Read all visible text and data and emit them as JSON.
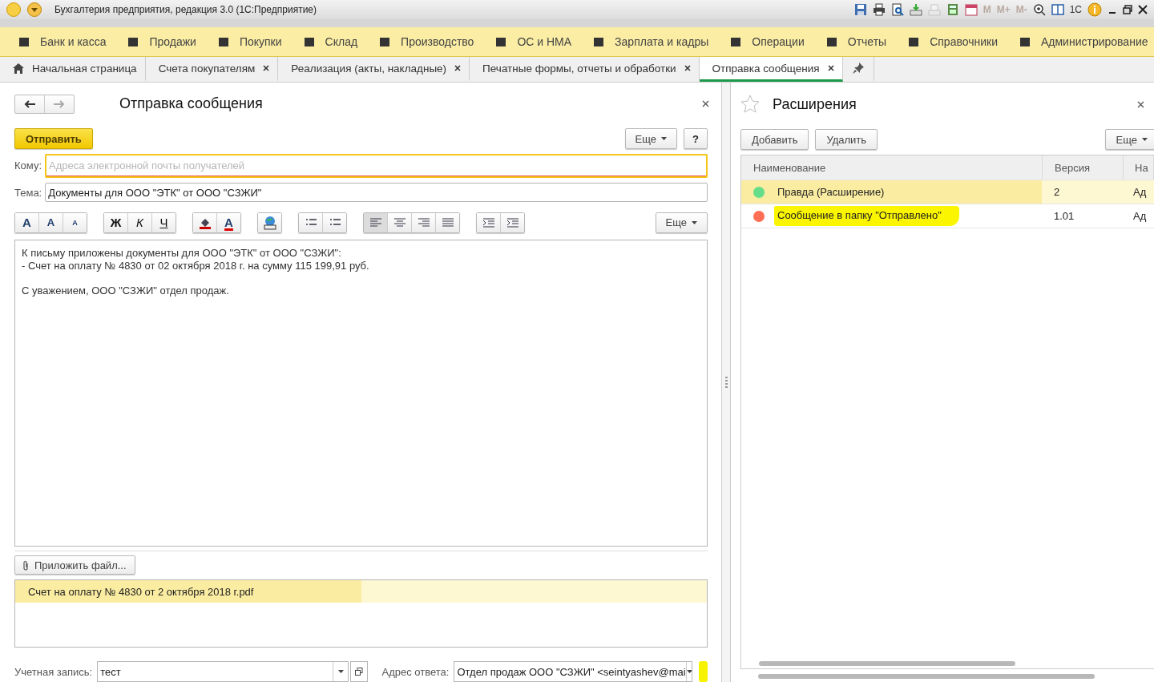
{
  "window": {
    "title": "Бухгалтерия предприятия, редакция 3.0  (1С:Предприятие)",
    "memory_buttons": [
      "M",
      "M+",
      "M-"
    ],
    "user": "1С"
  },
  "sections": [
    {
      "label": "Банк и касса"
    },
    {
      "label": "Продажи"
    },
    {
      "label": "Покупки"
    },
    {
      "label": "Склад"
    },
    {
      "label": "Производство"
    },
    {
      "label": "ОС и НМА"
    },
    {
      "label": "Зарплата и кадры"
    },
    {
      "label": "Операции"
    },
    {
      "label": "Отчеты"
    },
    {
      "label": "Справочники"
    },
    {
      "label": "Администрирование"
    }
  ],
  "tabs": [
    {
      "label": "Начальная страница",
      "kind": "home",
      "selected": false
    },
    {
      "label": "Счета покупателям",
      "kind": "document",
      "selected": false
    },
    {
      "label": "Реализация (акты, накладные)",
      "kind": "document",
      "selected": false
    },
    {
      "label": "Печатные формы, отчеты и обработки",
      "kind": "document",
      "selected": false
    },
    {
      "label": "Отправка сообщения",
      "kind": "document",
      "selected": true
    }
  ],
  "form": {
    "title": "Отправка сообщения",
    "send_button": "Отправить",
    "more_button": "Еще",
    "help_button": "?",
    "to": {
      "label": "Кому:",
      "placeholder": "Адреса электронной почты получателей"
    },
    "subject": {
      "label": "Тема:",
      "value": "Документы для ООО \"ЭТК\" от ООО \"СЗЖИ\""
    },
    "format_groups": [
      [
        {
          "kind": "font",
          "label": "A"
        },
        {
          "kind": "grow",
          "label": "A"
        },
        {
          "kind": "shrink",
          "label": "A"
        }
      ],
      [
        {
          "kind": "bold",
          "label": "Ж"
        },
        {
          "kind": "italic",
          "label": "К"
        },
        {
          "kind": "underline",
          "label": "Ч"
        }
      ],
      [
        {
          "kind": "fill"
        },
        {
          "kind": "color",
          "label": "A"
        }
      ],
      [
        {
          "kind": "image"
        }
      ],
      [
        {
          "kind": "bullets"
        },
        {
          "kind": "numbers"
        }
      ],
      [
        {
          "kind": "align-left",
          "selected": true
        },
        {
          "kind": "align-center",
          "selected": false
        },
        {
          "kind": "align-right",
          "selected": false
        },
        {
          "kind": "justify",
          "selected": false
        }
      ],
      [
        {
          "kind": "indent"
        },
        {
          "kind": "outdent"
        }
      ]
    ],
    "editor_more": "Еще",
    "body": [
      [
        "К письму приложены документы для ООО \"ЭТК\" от ООО \"СЗЖИ\":",
        "- Счет на оплату № 4830 от 02 октября 2018 г. на сумму 115 199,91 руб."
      ],
      [
        "С уважением, ООО \"СЗЖИ\" отдел продаж."
      ]
    ],
    "attach_button": "Приложить файл...",
    "attachments": [
      {
        "name": "Счет на оплату № 4830 от 2 октября 2018 г.pdf",
        "selected": true
      }
    ],
    "account": {
      "label": "Учетная запись:",
      "value": "тест"
    },
    "reply_to": {
      "label": "Адрес ответа:",
      "value": "Отдел продаж ООО \"СЗЖИ\" <seintyashev@mai"
    }
  },
  "extensions": {
    "title": "Расширения",
    "add_button": "Добавить",
    "delete_button": "Удалить",
    "more_button": "Еще",
    "columns": [
      "Наименование",
      "Версия",
      "На"
    ],
    "rows": [
      {
        "name": "Правда (Расширение)",
        "version": "2",
        "column_3": "Ад",
        "color": "#66dd88",
        "selected": true,
        "highlighted": false
      },
      {
        "name": "Сообщение в папку \"Отправлено\"",
        "version": "1.01",
        "column_3": "Ад",
        "color": "#ff6f55",
        "selected": false,
        "highlighted": true
      }
    ]
  }
}
